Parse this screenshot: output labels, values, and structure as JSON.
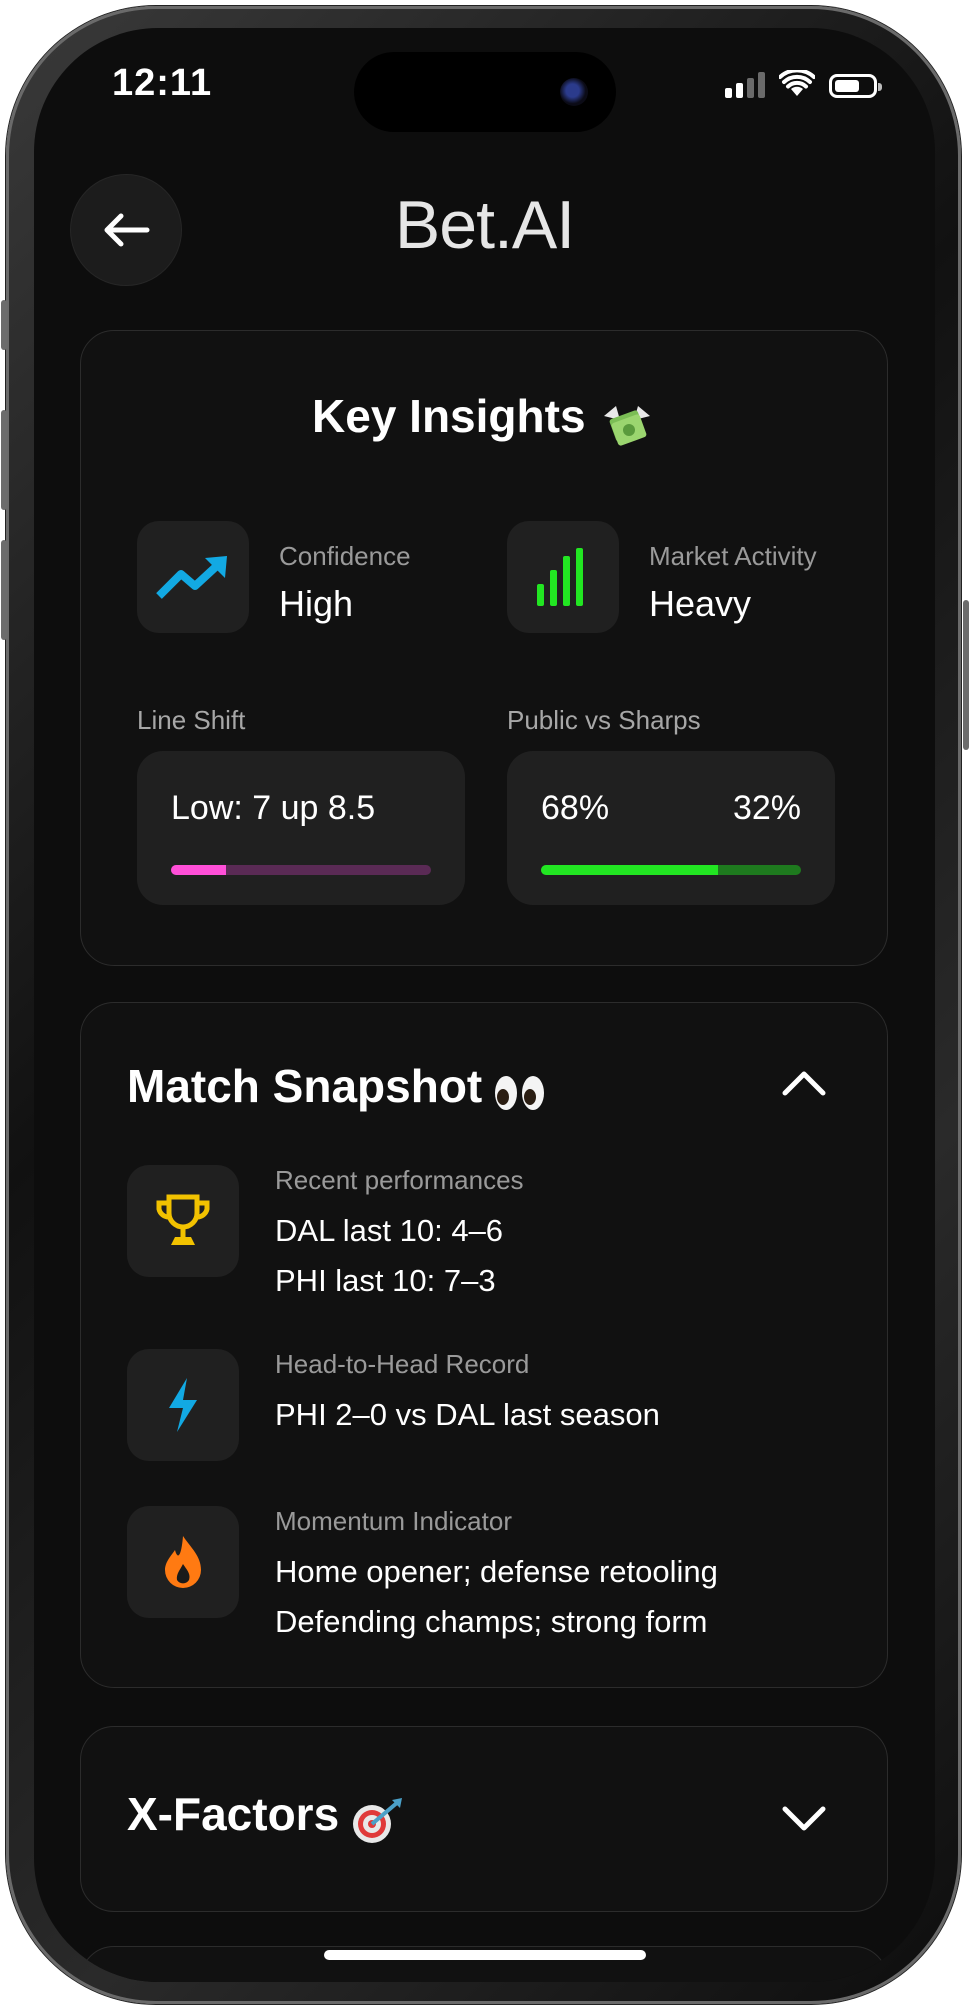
{
  "status": {
    "time": "12:11"
  },
  "header": {
    "title": "Bet.AI"
  },
  "key_insights": {
    "title": "Key Insights",
    "confidence": {
      "label": "Confidence",
      "value": "High"
    },
    "market": {
      "label": "Market Activity",
      "value": "Heavy"
    },
    "line_shift": {
      "label": "Line Shift",
      "text": "Low: 7 up 8.5",
      "fraction": 0.21
    },
    "public_sharps": {
      "label": "Public vs Sharps",
      "public": "68%",
      "sharps": "32%",
      "public_fraction": 0.68
    }
  },
  "match_snapshot": {
    "title": "Match Snapshot",
    "items": [
      {
        "label": "Recent performances",
        "lines": [
          "DAL last 10: 4–6",
          "PHI last 10: 7–3"
        ],
        "icon": "trophy-icon"
      },
      {
        "label": "Head-to-Head Record",
        "lines": [
          "PHI 2–0 vs DAL last season"
        ],
        "icon": "lightning-icon"
      },
      {
        "label": "Momentum Indicator",
        "lines": [
          "Home opener; defense retooling",
          "Defending champs; strong form"
        ],
        "icon": "flame-icon"
      }
    ]
  },
  "x_factors": {
    "title": "X-Factors"
  },
  "colors": {
    "accent_blue": "#12a9e3",
    "accent_green": "#22e622",
    "accent_pink": "#ff4fd8",
    "gold": "#f2c200",
    "orange": "#ff7a12"
  }
}
